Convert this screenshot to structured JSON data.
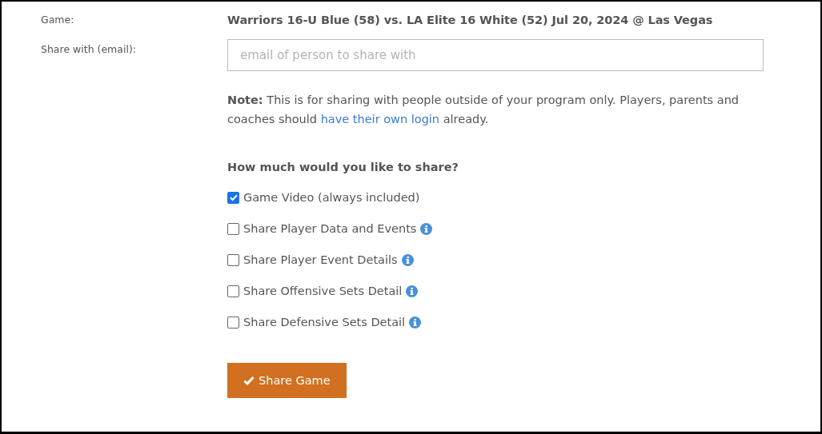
{
  "game": {
    "label": "Game:",
    "value": "Warriors 16-U Blue (58) vs. LA Elite 16 White (52) Jul 20, 2024 @ Las Vegas"
  },
  "share_with": {
    "label": "Share with (email):",
    "placeholder": "email of person to share with"
  },
  "note": {
    "text": "**Note:** This is for sharing with people outside of your program only. Players, parents and coaches should ",
    "link": "have their own login",
    "after": " already."
  },
  "options_heading": "How much would you like to share?",
  "options": [
    {
      "label": "Game Video (always included)",
      "checked": true,
      "info": false
    },
    {
      "label": "Share Player Data and Events",
      "checked": false,
      "info": true
    },
    {
      "label": "Share Player Event Details",
      "checked": false,
      "info": true
    },
    {
      "label": "Share Offensive Sets Detail",
      "checked": false,
      "info": true
    },
    {
      "label": "Share Defensive Sets Detail",
      "checked": false,
      "info": true
    }
  ],
  "submit": {
    "label": "Share Game"
  }
}
